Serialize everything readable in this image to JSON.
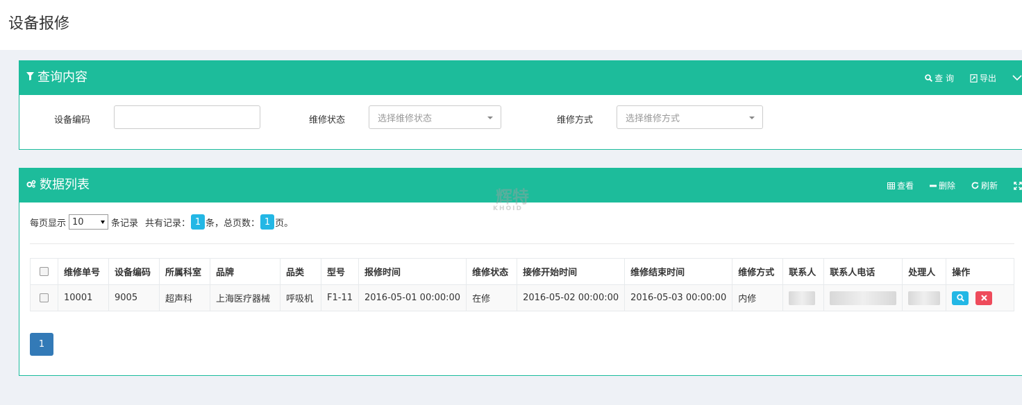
{
  "page": {
    "title": "设备报修"
  },
  "query_panel": {
    "title": "查询内容",
    "tools": {
      "search": "查 询",
      "export": "导出"
    },
    "fields": {
      "device_code_label": "设备编码",
      "device_code_value": "",
      "status_label": "维修状态",
      "status_placeholder": "选择维修状态",
      "method_label": "维修方式",
      "method_placeholder": "选择维修方式"
    }
  },
  "data_panel": {
    "title": "数据列表",
    "tools": {
      "view": "查看",
      "delete": "删除",
      "refresh": "刷新"
    },
    "pager": {
      "per_page_label": "每页显示",
      "page_size": "10",
      "records_label": "条记录",
      "total_label": "共有记录：",
      "total_count": "1",
      "total_suffix": "条，总页数：",
      "total_pages": "1",
      "pages_suffix": "页。"
    },
    "columns": [
      "维修单号",
      "设备编码",
      "所属科室",
      "品牌",
      "品类",
      "型号",
      "报修时间",
      "维修状态",
      "接修开始时间",
      "维修结束时间",
      "维修方式",
      "联系人",
      "联系人电话",
      "处理人",
      "操作"
    ],
    "rows": [
      {
        "order_no": "10001",
        "device_code": "9005",
        "department": "超声科",
        "brand": "上海医疗器械",
        "category": "呼吸机",
        "model": "F1-11",
        "report_time": "2016-05-01 00:00:00",
        "status": "在修",
        "start_time": "2016-05-02 00:00:00",
        "end_time": "2016-05-03 00:00:00",
        "method": "内修"
      }
    ],
    "current_page": "1"
  },
  "watermark": {
    "main": "辉特",
    "sub": "KHOID"
  },
  "colors": {
    "panel_header": "#1dbc9b",
    "badge": "#23b7e5",
    "page_button": "#337ab7",
    "danger": "#ee4b5b"
  }
}
